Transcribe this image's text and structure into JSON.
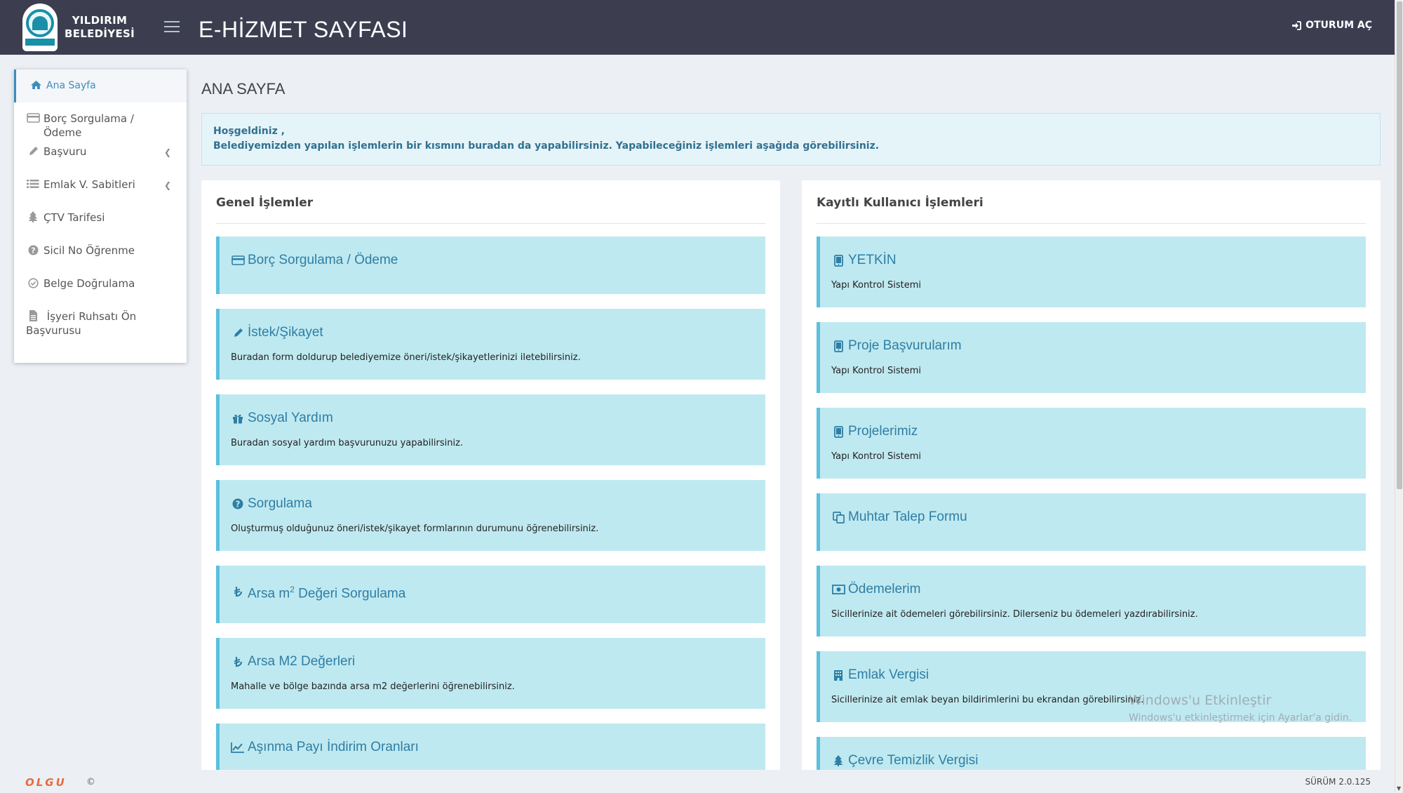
{
  "header": {
    "logo_line1": "YILDIRIM",
    "logo_line2": "BELEDİYESİ",
    "title": "E-HİZMET SAYFASI",
    "login_label": "OTURUM AÇ"
  },
  "sidebar": {
    "items": [
      {
        "label": "Ana Sayfa",
        "icon": "home-icon",
        "active": true
      },
      {
        "label": "Borç Sorgulama / Ödeme",
        "icon": "credit-card-icon"
      },
      {
        "label": "Başvuru",
        "icon": "pencil-icon",
        "has_children": true
      },
      {
        "label": "Emlak V. Sabitleri",
        "icon": "list-icon",
        "has_children": true
      },
      {
        "label": "ÇTV Tarifesi",
        "icon": "tree-icon"
      },
      {
        "label": "Sicil No Öğrenme",
        "icon": "question-circle-icon"
      },
      {
        "label": "Belge Doğrulama",
        "icon": "check-circle-icon"
      },
      {
        "label": "İşyeri Ruhsatı Ön Başvurusu",
        "icon": "file-icon"
      }
    ]
  },
  "main": {
    "heading": "ANA SAYFA",
    "welcome_line1": "Hoşgeldiniz ,",
    "welcome_line2": "Belediyemizden yapılan işlemlerin bir kısmını buradan da yapabilirsiniz. Yapabileceğiniz işlemleri aşağıda görebilirsiniz."
  },
  "general_panel": {
    "title": "Genel İşlemler",
    "cards": [
      {
        "title": "Borç Sorgulama / Ödeme",
        "desc": "",
        "icon": "credit-card-icon"
      },
      {
        "title": "İstek/Şikayet",
        "desc": "Buradan form doldurup belediyemize öneri/istek/şikayetlerinizi iletebilirsiniz.",
        "icon": "pencil-icon"
      },
      {
        "title": "Sosyal Yardım",
        "desc": "Buradan sosyal yardım başvurunuzu yapabilirsiniz.",
        "icon": "gift-icon"
      },
      {
        "title": "Sorgulama",
        "desc": "Oluşturmuş olduğunuz öneri/istek/şikayet formlarının durumunu öğrenebilirsiniz.",
        "icon": "question-circle-icon"
      },
      {
        "title_prefix": "Arsa m",
        "title_sup": "2",
        "title_suffix": " Değeri Sorgulama",
        "desc": "",
        "icon": "lira-icon"
      },
      {
        "title": "Arsa M2 Değerleri",
        "desc": "Mahalle ve bölge bazında arsa m2 değerlerini öğrenebilirsiniz.",
        "icon": "lira-icon"
      },
      {
        "title": "Aşınma Payı İndirim Oranları",
        "desc": "",
        "icon": "line-chart-icon"
      }
    ]
  },
  "user_panel": {
    "title": "Kayıtlı Kullanıcı İşlemleri",
    "cards": [
      {
        "title": "YETKİN",
        "desc": "Yapı Kontrol Sistemi",
        "icon": "tablet-icon"
      },
      {
        "title": "Proje Başvurularım",
        "desc": "Yapı Kontrol Sistemi",
        "icon": "tablet-icon"
      },
      {
        "title": "Projelerimiz",
        "desc": "Yapı Kontrol Sistemi",
        "icon": "tablet-icon"
      },
      {
        "title": "Muhtar Talep Formu",
        "desc": "",
        "icon": "copy-icon"
      },
      {
        "title": "Ödemelerim",
        "desc": "Sicillerinize ait ödemeleri görebilirsiniz. Dilerseniz bu ödemeleri yazdırabilirsiniz.",
        "icon": "money-icon"
      },
      {
        "title": "Emlak Vergisi",
        "desc": "Sicillerinize ait emlak beyan bildirimlerini bu ekrandan görebilirsiniz.",
        "icon": "building-icon"
      },
      {
        "title": "Çevre Temizlik Vergisi",
        "desc": "",
        "icon": "tree-icon"
      }
    ]
  },
  "footer": {
    "brand": "OLGU",
    "copyright": "©",
    "version": "SÜRÜM 2.0.125"
  },
  "watermark": {
    "line1": "Windows'u Etkinleştir",
    "line2": "Windows'u etkinleştirmek için Ayarlar'a gidin."
  },
  "colors": {
    "header_bg": "#3c3e50",
    "card_bg": "#bfe9f0",
    "card_accent": "#5bc0de",
    "card_title": "#2e7ea5",
    "callout_text": "#31708f"
  }
}
